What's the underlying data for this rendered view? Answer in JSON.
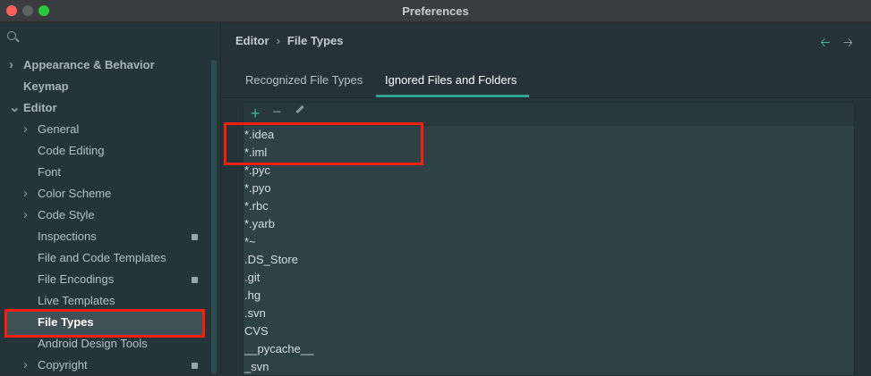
{
  "window": {
    "title": "Preferences"
  },
  "sidebar": {
    "items": [
      {
        "label": "Appearance & Behavior",
        "style": "bold",
        "arrow": "right"
      },
      {
        "label": "Keymap",
        "style": "bold",
        "arrow": ""
      },
      {
        "label": "Editor",
        "style": "bold",
        "arrow": "down"
      },
      {
        "label": "General",
        "arrow": "right"
      },
      {
        "label": "Code Editing",
        "arrow": ""
      },
      {
        "label": "Font",
        "arrow": ""
      },
      {
        "label": "Color Scheme",
        "arrow": "right"
      },
      {
        "label": "Code Style",
        "arrow": "right"
      },
      {
        "label": "Inspections",
        "arrow": "",
        "badge": true
      },
      {
        "label": "File and Code Templates",
        "arrow": ""
      },
      {
        "label": "File Encodings",
        "arrow": "",
        "badge": true
      },
      {
        "label": "Live Templates",
        "arrow": ""
      },
      {
        "label": "File Types",
        "arrow": "",
        "selected": true
      },
      {
        "label": "Android Design Tools",
        "arrow": ""
      },
      {
        "label": "Copyright",
        "arrow": "right",
        "badge": true
      }
    ]
  },
  "breadcrumb": {
    "parent": "Editor",
    "separator": "›",
    "current": "File Types"
  },
  "tabs": [
    {
      "label": "Recognized File Types",
      "active": false
    },
    {
      "label": "Ignored Files and Folders",
      "active": true
    }
  ],
  "toolbar": {
    "add": "+",
    "remove": "−"
  },
  "ignored": [
    "*.idea",
    "*.iml",
    "*.pyc",
    "*.pyo",
    "*.rbc",
    "*.yarb",
    "*~",
    ".DS_Store",
    ".git",
    ".hg",
    ".svn",
    "CVS",
    "__pycache__",
    "_svn"
  ],
  "colors": {
    "accent": "#2fa58f",
    "highlight": "#f5200b",
    "add": "#3fb68f"
  }
}
